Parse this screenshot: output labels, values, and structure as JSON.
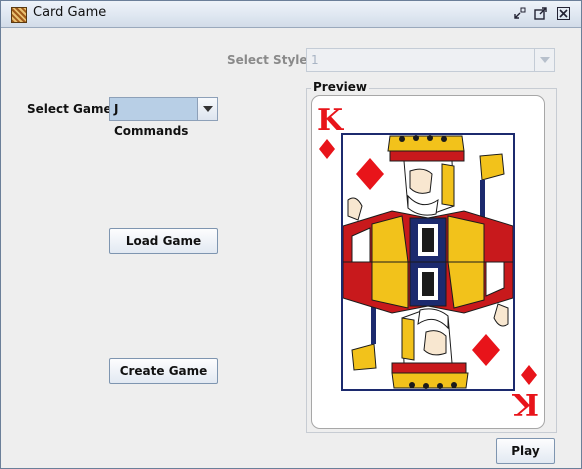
{
  "window": {
    "title": "Card Game"
  },
  "style_select": {
    "label": "Select Style",
    "value": "1"
  },
  "game_select": {
    "label": "Select Game",
    "value": "J Commands"
  },
  "buttons": {
    "load": "Load Game",
    "create": "Create Game",
    "play": "Play"
  },
  "preview": {
    "legend": "Preview",
    "card": {
      "rank": "K",
      "suit": "diamonds",
      "suit_symbol": "♦",
      "color": "#e8141a"
    }
  },
  "icons": [
    "card-game-app-icon",
    "minimize-icon",
    "maximize-icon",
    "close-icon",
    "chevron-down-icon"
  ]
}
